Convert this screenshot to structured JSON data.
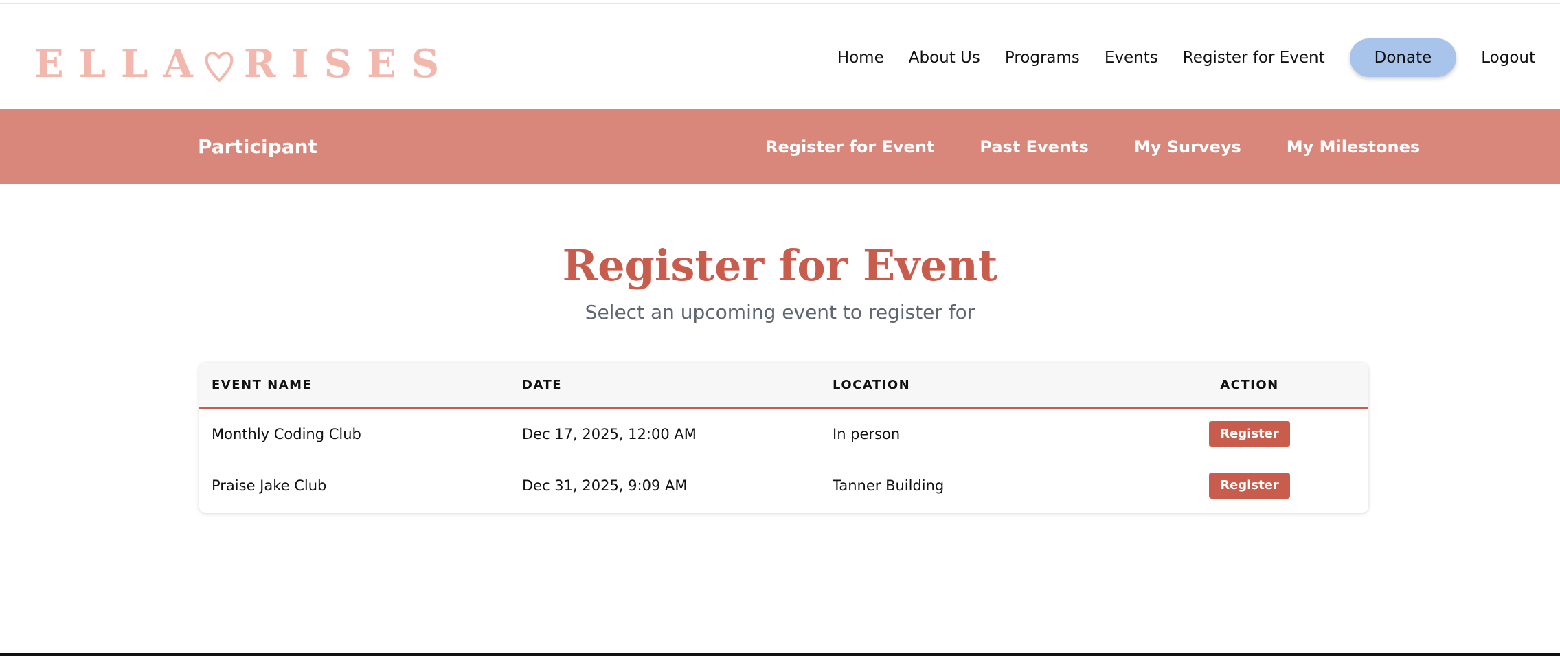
{
  "header": {
    "logo_text_left": "ELLA",
    "logo_text_right": "RISES",
    "nav": {
      "home": "Home",
      "about": "About Us",
      "programs": "Programs",
      "events": "Events",
      "register": "Register for Event",
      "donate": "Donate",
      "logout": "Logout"
    }
  },
  "subnav": {
    "role": "Participant",
    "links": [
      "Register for Event",
      "Past Events",
      "My Surveys",
      "My Milestones"
    ]
  },
  "page": {
    "title": "Register for Event",
    "subtitle": "Select an upcoming event to register for"
  },
  "table": {
    "headers": {
      "name": "EVENT NAME",
      "date": "DATE",
      "location": "LOCATION",
      "action": "ACTION"
    },
    "rows": [
      {
        "name": "Monthly Coding Club",
        "date": "Dec 17, 2025, 12:00 AM",
        "location": "In person",
        "action": "Register"
      },
      {
        "name": "Praise Jake Club",
        "date": "Dec 31, 2025, 9:09 AM",
        "location": "Tanner Building",
        "action": "Register"
      }
    ]
  },
  "colors": {
    "brand_pink": "#f2b8ad",
    "subnav_bg": "#da877b",
    "accent": "#c85d4e",
    "donate_bg": "#a8c4ea"
  }
}
